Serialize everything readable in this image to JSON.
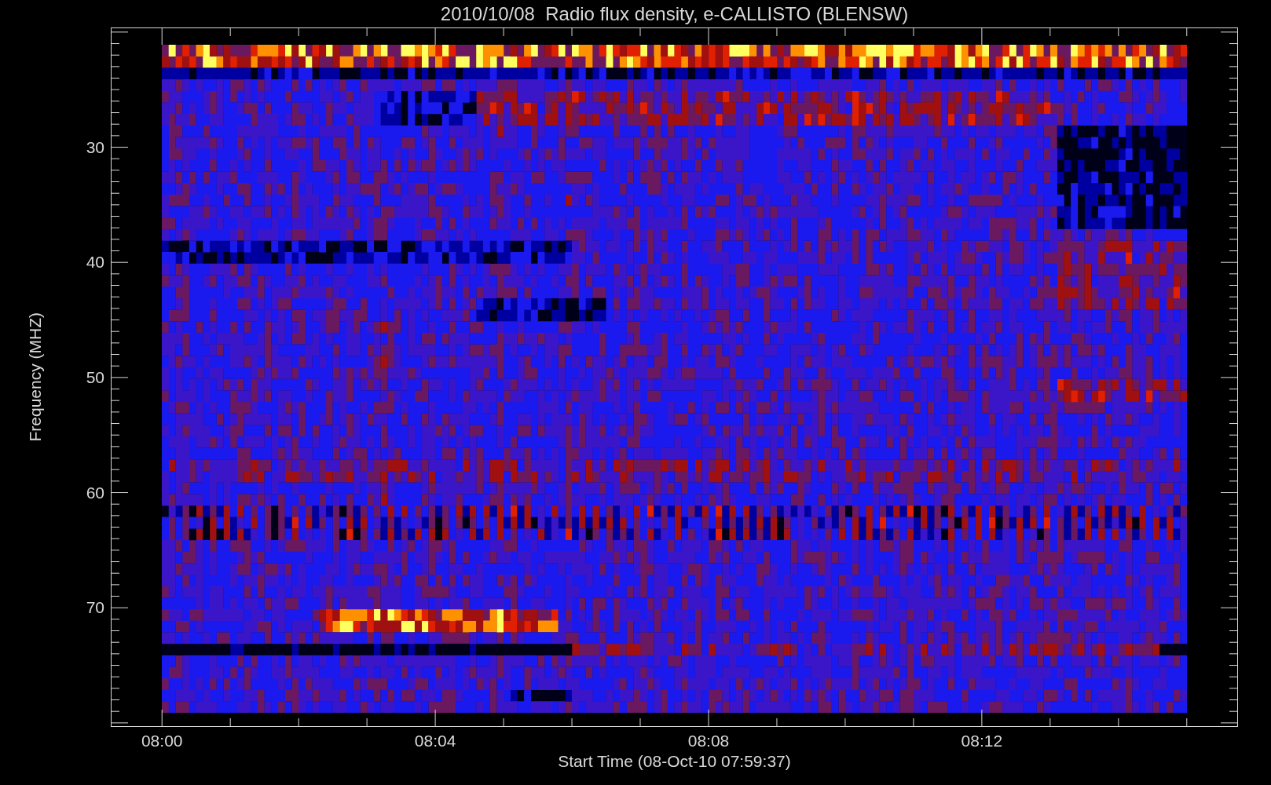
{
  "title": "2010/10/08  Radio flux density, e-CALLISTO (BLENSW)",
  "y_axis": {
    "label": "Frequency (MHZ)",
    "ticks": [
      "30",
      "40",
      "50",
      "60",
      "70"
    ]
  },
  "x_axis": {
    "label": "Start Time (08-Oct-10 07:59:37)",
    "ticks": [
      "08:00",
      "08:04",
      "08:08",
      "08:12"
    ]
  }
}
